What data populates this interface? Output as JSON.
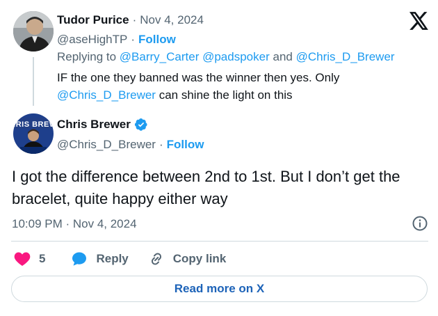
{
  "reply_tweet": {
    "author_name": "Tudor Purice",
    "separator": "·",
    "date": "Nov 4, 2024",
    "handle": "@aseHighTP",
    "follow_label": "Follow",
    "replying_to_label": "Replying to",
    "replying_to": [
      "@Barry_Carter",
      "@padspoker",
      "and",
      "@Chris_D_Brewer"
    ],
    "text_line1": "IF the one they banned was the winner then yes. Only",
    "text_mention": "@Chris_D_Brewer",
    "text_line2_rest": "can shine the light on this"
  },
  "main_tweet": {
    "author_name": "Chris Brewer",
    "verified": true,
    "handle": "@Chris_D_Brewer",
    "follow_label": "Follow",
    "text": "I got the difference between 2nd to 1st. But I don’t get the bracelet, quite happy either way",
    "timestamp": "10:09 PM · Nov 4, 2024"
  },
  "actions": {
    "like_count": "5",
    "reply_label": "Reply",
    "copy_link_label": "Copy link"
  },
  "read_more_label": "Read more on X",
  "colors": {
    "accent": "#1d9bf0",
    "like": "#f91880",
    "muted": "#536471",
    "verified": "#1d9bf0"
  },
  "icons": [
    "x-logo-icon",
    "verified-badge-icon",
    "info-icon",
    "heart-icon",
    "reply-bubble-icon",
    "link-icon"
  ]
}
